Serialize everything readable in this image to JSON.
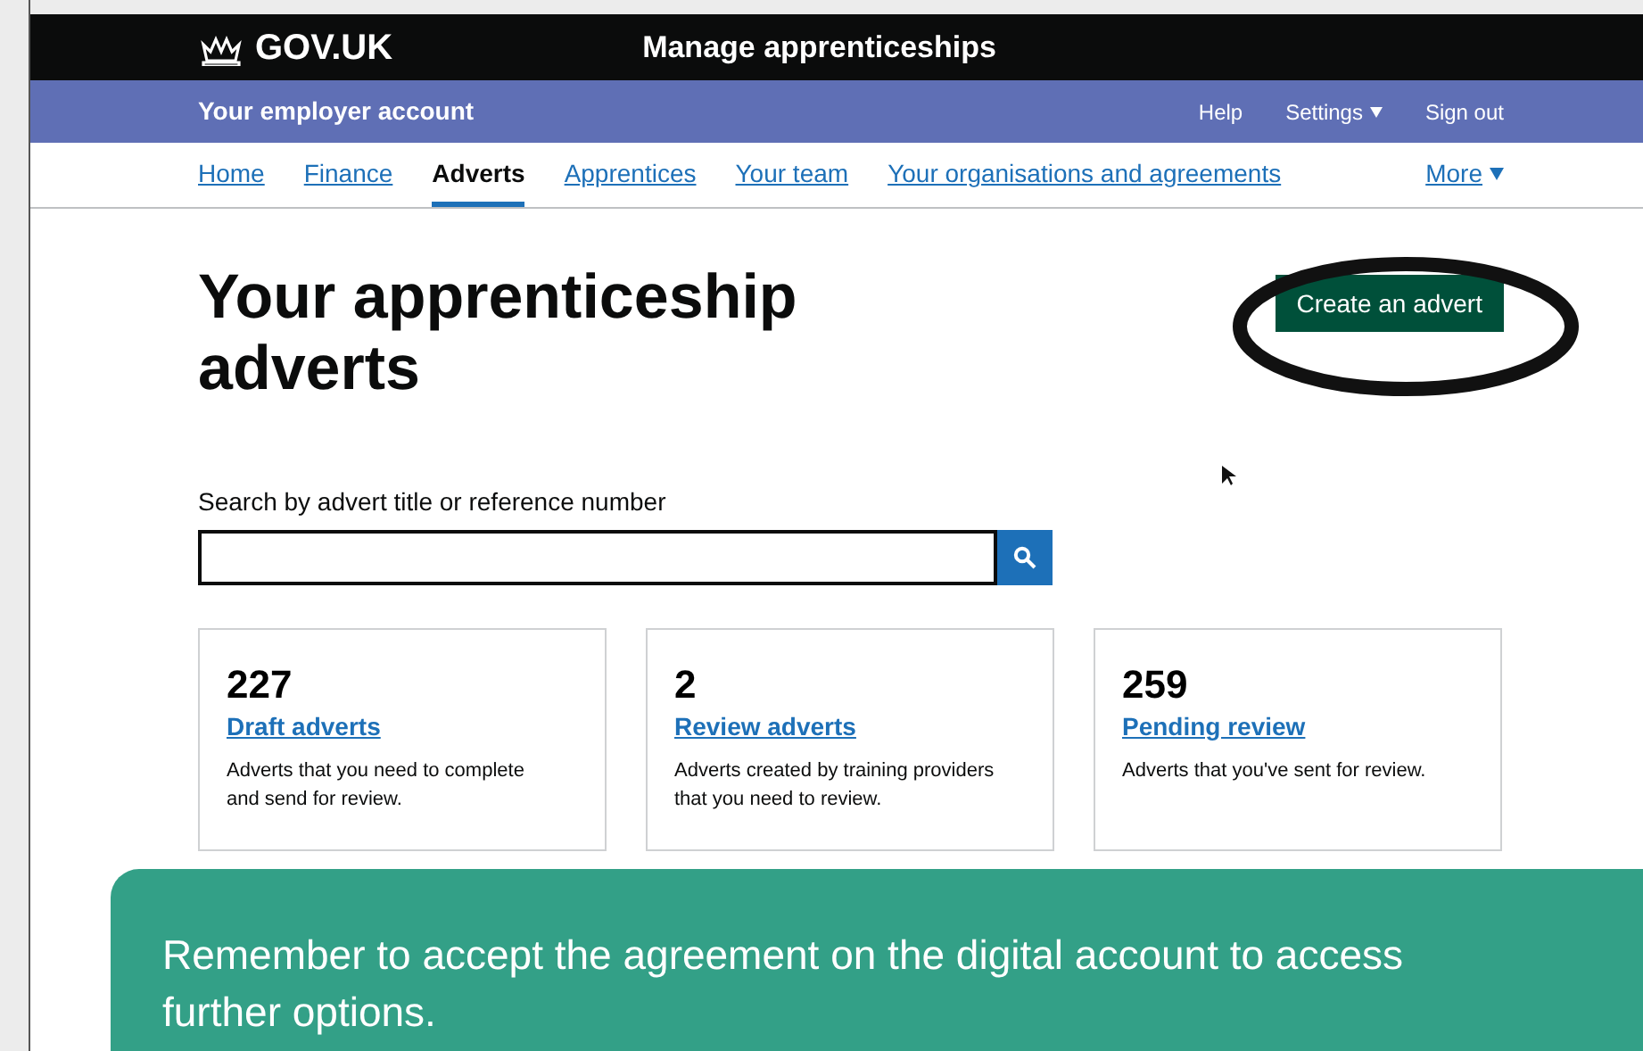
{
  "header": {
    "logo": "GOV.UK",
    "service": "Manage apprenticeships"
  },
  "account_bar": {
    "title": "Your employer account",
    "links": [
      {
        "label": "Help",
        "dropdown": false
      },
      {
        "label": "Settings",
        "dropdown": true
      },
      {
        "label": "Sign out",
        "dropdown": false
      }
    ]
  },
  "nav": {
    "items": [
      {
        "label": "Home",
        "selected": false
      },
      {
        "label": "Finance",
        "selected": false
      },
      {
        "label": "Adverts",
        "selected": true
      },
      {
        "label": "Apprentices",
        "selected": false
      },
      {
        "label": "Your team",
        "selected": false
      },
      {
        "label": "Your organisations and agreements",
        "selected": false
      }
    ],
    "more": "More"
  },
  "heading": "Your apprenticeship adverts",
  "create_button": "Create an advert",
  "search": {
    "label": "Search by advert title or reference number"
  },
  "cards": [
    {
      "count": "227",
      "link": "Draft adverts",
      "description": "Adverts that you need to complete and send for review."
    },
    {
      "count": "2",
      "link": "Review adverts",
      "description": "Adverts created by training providers that you need to review."
    },
    {
      "count": "259",
      "link": "Pending review",
      "description": "Adverts that you've sent for review."
    }
  ],
  "callout": "Remember to accept the agreement on the digital account to access further options."
}
